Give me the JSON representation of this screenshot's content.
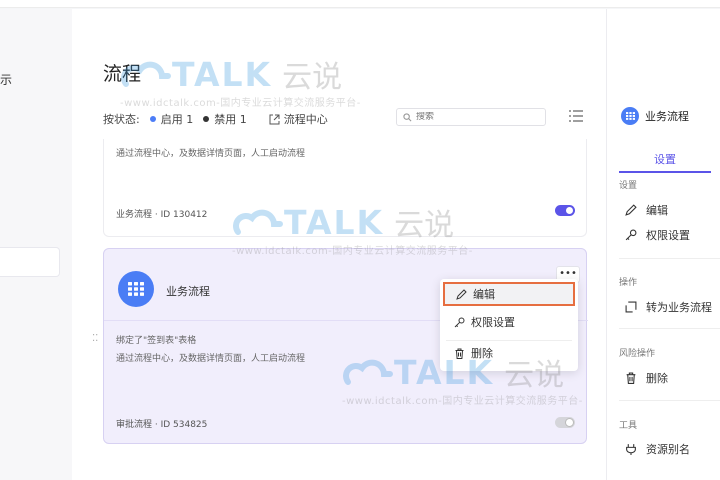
{
  "sidebar": {
    "partial_label": "示"
  },
  "page": {
    "title": "流程"
  },
  "filters": {
    "status_label": "按状态:",
    "enabled": {
      "label": "启用",
      "count": "1"
    },
    "disabled": {
      "label": "禁用",
      "count": "1"
    },
    "flow_center": "流程中心"
  },
  "search": {
    "placeholder": "搜索"
  },
  "cards": [
    {
      "desc": "通过流程中心，及数据详情页面，人工启动流程",
      "meta": "业务流程 · ID 130412",
      "enabled": true
    },
    {
      "name": "业务流程",
      "binding": "绑定了\"签到表\"表格",
      "desc": "通过流程中心，及数据详情页面，人工启动流程",
      "meta": "审批流程 · ID 534825",
      "enabled": false,
      "more_label": "•••"
    }
  ],
  "context_menu": {
    "edit": "编辑",
    "permissions": "权限设置",
    "delete": "删除"
  },
  "right_panel": {
    "title": "业务流程",
    "tab": "设置",
    "sections": {
      "settings": "设置",
      "operations": "操作",
      "risk": "风险操作",
      "tools": "工具"
    },
    "items": {
      "edit": "编辑",
      "permissions": "权限设置",
      "convert": "转为业务流程",
      "delete": "删除",
      "alias": "资源别名"
    }
  },
  "watermark": {
    "brand": "TALK",
    "cn": "云说",
    "url": "-www.idctalk.com-国内专业云计算交流服务平台-"
  },
  "colors": {
    "accent": "#5b54e8",
    "app_icon": "#4a7df5",
    "highlight_border": "#e66e40"
  }
}
